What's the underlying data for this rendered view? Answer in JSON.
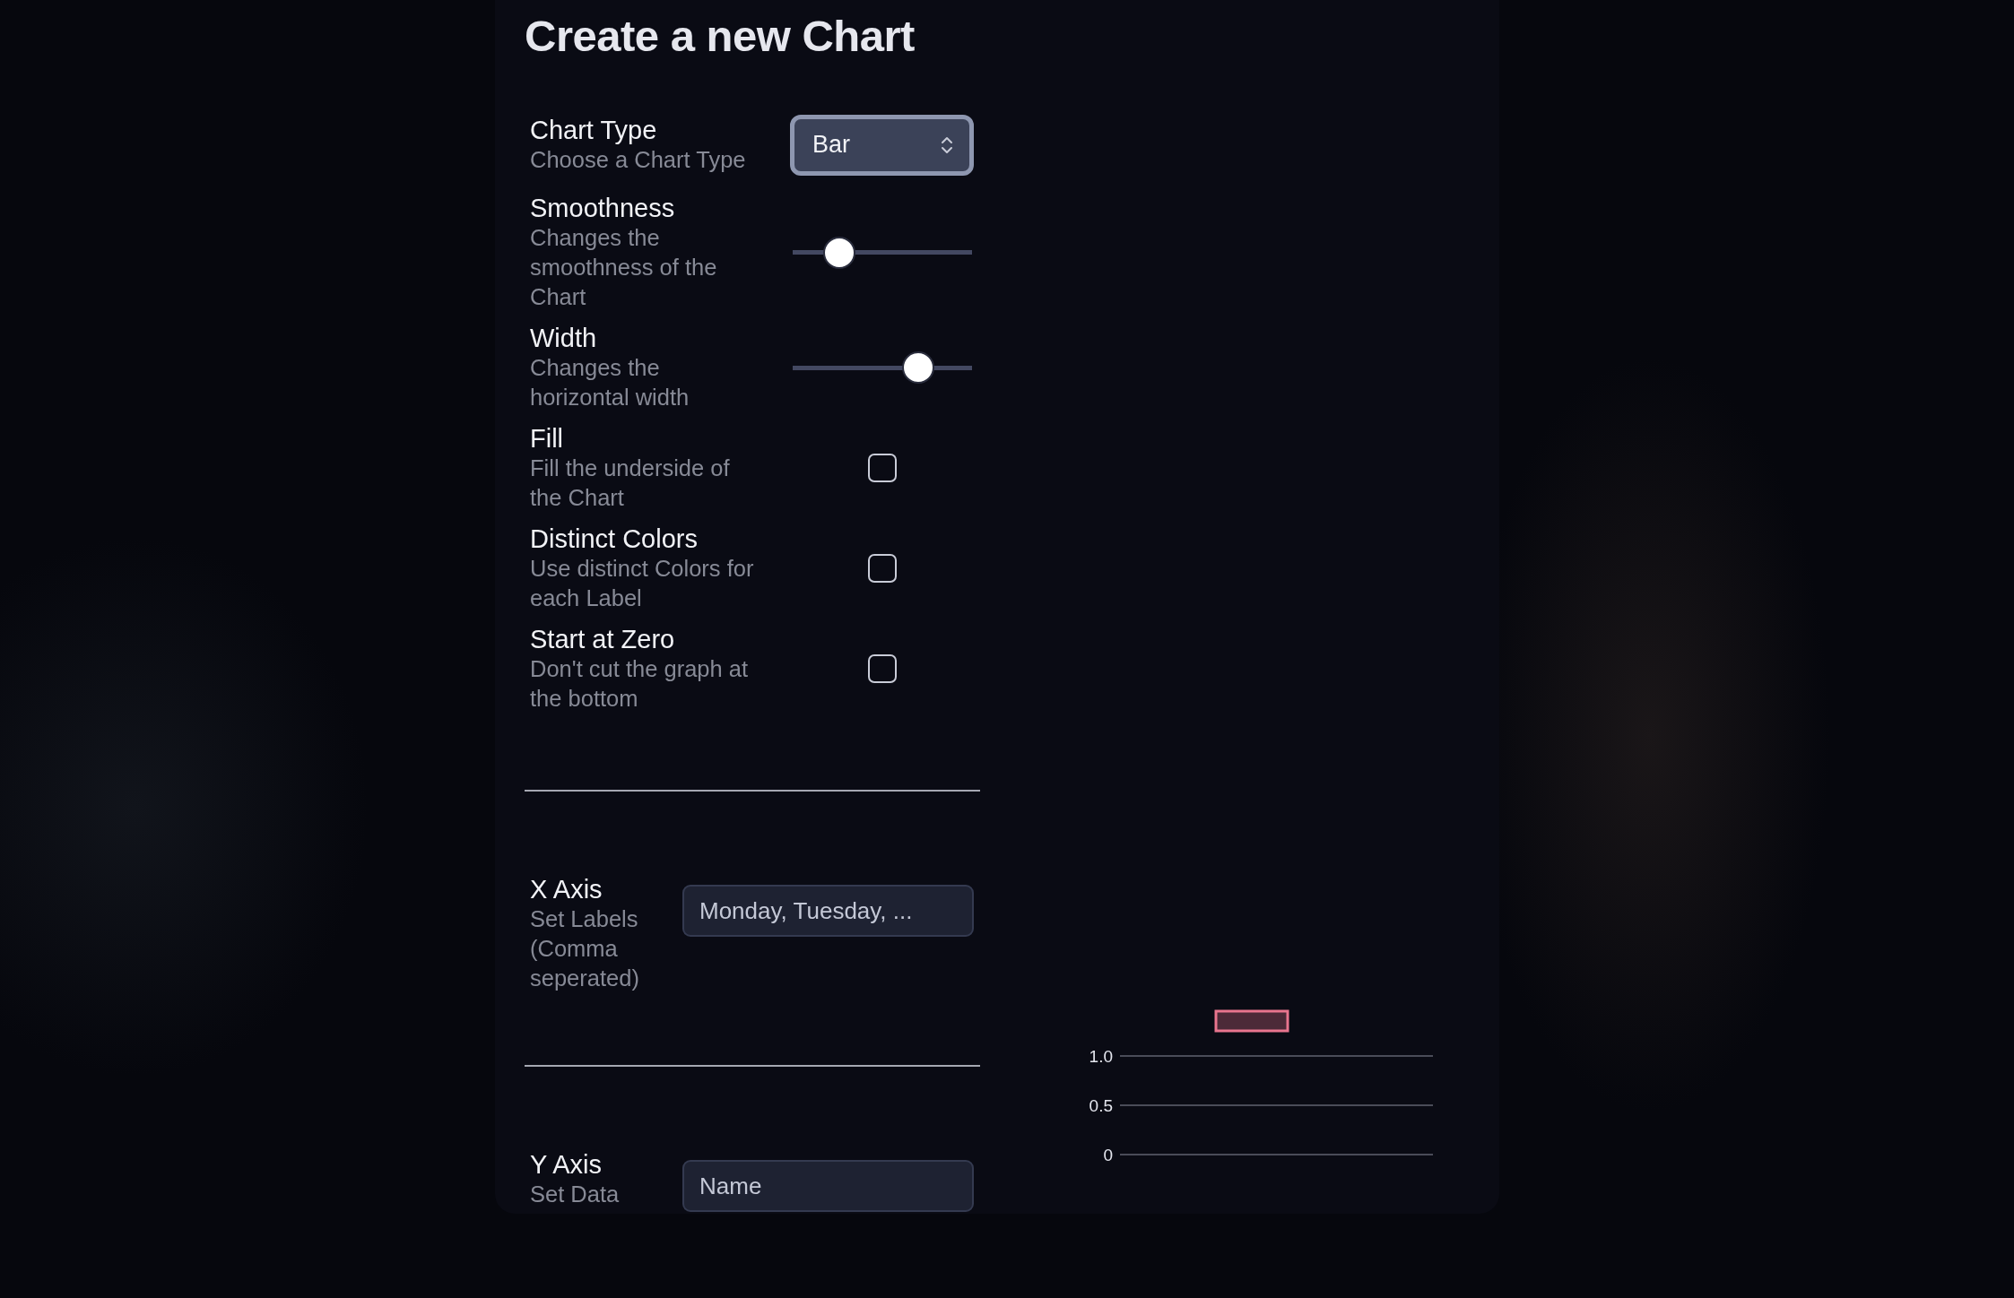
{
  "title": "Create a new Chart",
  "settings": [
    {
      "kind": "select",
      "label": "Chart Type",
      "description": "Choose a Chart Type",
      "value": "Bar"
    },
    {
      "kind": "slider",
      "label": "Smoothness",
      "description": "Changes the smoothness of the Chart",
      "level": 0.26
    },
    {
      "kind": "slider",
      "label": "Width",
      "description": "Changes the horizontal width",
      "level": 0.7
    },
    {
      "kind": "checkbox",
      "label": "Fill",
      "description": "Fill the underside of the Chart",
      "checked": false
    },
    {
      "kind": "checkbox",
      "label": "Distinct Colors",
      "description": "Use distinct Colors for each Label",
      "checked": false
    },
    {
      "kind": "checkbox",
      "label": "Start at Zero",
      "description": "Don't cut the graph at the bottom",
      "checked": false
    }
  ],
  "axes": [
    {
      "label": "X Axis",
      "description": "Set Labels (Comma seperated)",
      "placeholder": "Monday, Tuesday, ..."
    },
    {
      "label": "Y Axis",
      "description": "Set Data",
      "placeholder": "Name"
    }
  ],
  "preview": {
    "chart_data": {
      "type": "bar",
      "ylim": [
        0,
        1
      ],
      "yticks": [
        {
          "value": 1,
          "label": "1.0"
        },
        {
          "value": 0.5,
          "label": "0.5"
        },
        {
          "value": 0,
          "label": "0"
        }
      ],
      "series": [
        {
          "color": "#e8758e"
        }
      ]
    }
  }
}
